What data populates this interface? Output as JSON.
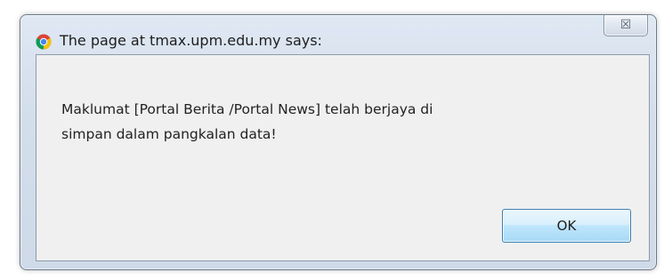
{
  "dialog": {
    "title": "The page at tmax.upm.edu.my says:",
    "title_icon": "chrome-icon",
    "close_label": "☒",
    "message_line1": "Maklumat [Portal Berita /Portal News] telah berjaya di",
    "message_line2": "simpan dalam pangkalan data!",
    "ok_label": "OK"
  }
}
